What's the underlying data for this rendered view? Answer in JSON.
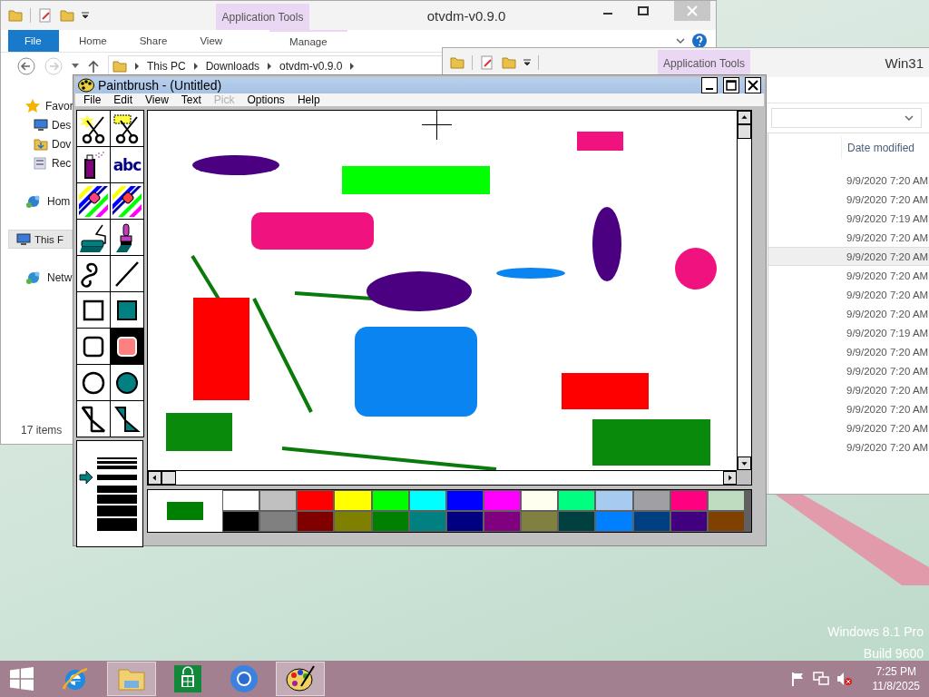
{
  "explorer_back": {
    "title": "otvdm-v0.9.0",
    "context_tab": "Application Tools",
    "ribbon_tabs": [
      {
        "label": "File",
        "selected": true
      },
      {
        "label": "Home",
        "selected": false
      },
      {
        "label": "Share",
        "selected": false
      },
      {
        "label": "View",
        "selected": false
      },
      {
        "label": "Manage",
        "selected": false
      }
    ],
    "breadcrumb": [
      "This PC",
      "Downloads",
      "otvdm-v0.9.0"
    ],
    "nav_items": [
      {
        "label": "Favor",
        "kind": "star",
        "selected": false,
        "children": [
          {
            "label": "Des",
            "kind": "desktop",
            "selected": false
          },
          {
            "label": "Dov",
            "kind": "downloads",
            "selected": false
          },
          {
            "label": "Rec",
            "kind": "recent",
            "selected": false
          }
        ]
      },
      {
        "label": "Hom",
        "kind": "homegroup",
        "selected": false
      },
      {
        "label": "This F",
        "kind": "computer",
        "selected": true
      },
      {
        "label": "Netw",
        "kind": "network",
        "selected": false
      }
    ],
    "status": "17 items"
  },
  "explorer_front": {
    "title": "Win31",
    "context_tab": "Application Tools",
    "column_header": "Date modified",
    "rows": [
      {
        "date": "9/9/2020 7:20 AM",
        "selected": false
      },
      {
        "date": "9/9/2020 7:20 AM",
        "selected": false
      },
      {
        "date": "9/9/2020 7:19 AM",
        "selected": false
      },
      {
        "date": "9/9/2020 7:20 AM",
        "selected": false
      },
      {
        "date": "9/9/2020 7:20 AM",
        "selected": true
      },
      {
        "date": "9/9/2020 7:20 AM",
        "selected": false
      },
      {
        "date": "9/9/2020 7:20 AM",
        "selected": false
      },
      {
        "date": "9/9/2020 7:20 AM",
        "selected": false
      },
      {
        "date": "9/9/2020 7:19 AM",
        "selected": false
      },
      {
        "date": "9/9/2020 7:20 AM",
        "selected": false
      },
      {
        "date": "9/9/2020 7:20 AM",
        "selected": false
      },
      {
        "date": "9/9/2020 7:20 AM",
        "selected": false
      },
      {
        "date": "9/9/2020 7:20 AM",
        "selected": false
      },
      {
        "date": "9/9/2020 7:20 AM",
        "selected": false
      },
      {
        "date": "9/9/2020 7:20 AM",
        "selected": false
      }
    ]
  },
  "paintbrush": {
    "title": "Paintbrush - (Untitled)",
    "menu": [
      {
        "label": "File",
        "disabled": false
      },
      {
        "label": "Edit",
        "disabled": false
      },
      {
        "label": "View",
        "disabled": false
      },
      {
        "label": "Text",
        "disabled": false
      },
      {
        "label": "Pick",
        "disabled": true
      },
      {
        "label": "Options",
        "disabled": false
      },
      {
        "label": "Help",
        "disabled": false
      }
    ],
    "tools": [
      {
        "kind": "pick-star",
        "selected": false
      },
      {
        "kind": "pick-rect",
        "selected": false
      },
      {
        "kind": "airbrush",
        "selected": false
      },
      {
        "kind": "text",
        "label": "abc",
        "selected": false
      },
      {
        "kind": "color-eraser",
        "selected": false
      },
      {
        "kind": "eraser",
        "selected": false
      },
      {
        "kind": "roller",
        "selected": false
      },
      {
        "kind": "brush",
        "selected": false
      },
      {
        "kind": "curve",
        "selected": false
      },
      {
        "kind": "line",
        "selected": false
      },
      {
        "kind": "box",
        "selected": false
      },
      {
        "kind": "filled-box",
        "selected": false
      },
      {
        "kind": "rounded-box",
        "selected": false
      },
      {
        "kind": "filled-rounded-box",
        "selected": true
      },
      {
        "kind": "circle",
        "selected": false
      },
      {
        "kind": "filled-circle",
        "selected": false
      },
      {
        "kind": "polygon",
        "selected": false
      },
      {
        "kind": "filled-polygon",
        "selected": false
      }
    ],
    "line_widths": [
      {
        "selected": false
      },
      {
        "selected": false
      },
      {
        "selected": false
      },
      {
        "selected": true
      },
      {
        "selected": false
      },
      {
        "selected": false
      },
      {
        "selected": false
      },
      {
        "selected": false
      }
    ],
    "palette": {
      "current_colors": [
        {
          "kind": "background",
          "color": "#ffffff"
        },
        {
          "kind": "foreground",
          "color": "#008000"
        }
      ],
      "colors": [
        {
          "color": "#ffffff"
        },
        {
          "color": "#c0c0c0"
        },
        {
          "color": "#ff0000"
        },
        {
          "color": "#ffff00"
        },
        {
          "color": "#00ff00"
        },
        {
          "color": "#00ffff"
        },
        {
          "color": "#0000ff"
        },
        {
          "color": "#ff00ff"
        },
        {
          "color": "#fffff0"
        },
        {
          "color": "#00ff80"
        },
        {
          "color": "#a6caf0"
        },
        {
          "color": "#a0a0a4"
        },
        {
          "color": "#ff0080"
        },
        {
          "color": "#c0dcc0"
        },
        {
          "color": "#000000"
        },
        {
          "color": "#808080"
        },
        {
          "color": "#800000"
        },
        {
          "color": "#808000"
        },
        {
          "color": "#008000"
        },
        {
          "color": "#008080"
        },
        {
          "color": "#000080"
        },
        {
          "color": "#800080"
        },
        {
          "color": "#808040"
        },
        {
          "color": "#004040"
        },
        {
          "color": "#0080ff"
        },
        {
          "color": "#004080"
        },
        {
          "color": "#400080"
        },
        {
          "color": "#804000"
        }
      ]
    }
  },
  "desktop": {
    "watermark": [
      "Windows 8.1 Pro",
      "Build 9600"
    ]
  },
  "taskbar": {
    "apps": [
      {
        "kind": "start",
        "active": false
      },
      {
        "kind": "ie",
        "active": false
      },
      {
        "kind": "explorer",
        "active": true
      },
      {
        "kind": "store",
        "active": false
      },
      {
        "kind": "browser",
        "active": false
      },
      {
        "kind": "paint",
        "active": true
      }
    ],
    "time": "7:25 PM",
    "date": "11/8/2025"
  }
}
